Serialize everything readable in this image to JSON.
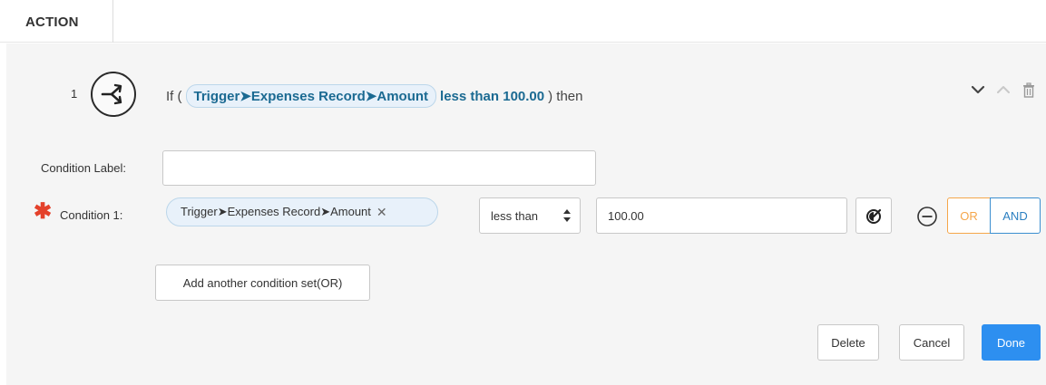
{
  "header": {
    "tab_label": "ACTION"
  },
  "step": {
    "number": "1",
    "icon": "branch-condition-icon",
    "summary": {
      "prefix": "If (",
      "field": "Trigger➤Expenses Record➤Amount",
      "operator_value": "less than 100.00",
      "suffix": ") then"
    },
    "controls": [
      "chevron-down-icon",
      "chevron-up-icon",
      "trash-icon"
    ]
  },
  "form": {
    "condition_label": {
      "label": "Condition Label:",
      "value": "",
      "placeholder": ""
    },
    "condition_1": {
      "required_mark": "✱",
      "label": "Condition 1:",
      "field": "Trigger➤Expenses Record➤Amount",
      "remove_symbol": "✕",
      "operator": "less than",
      "value": "100.00"
    },
    "or_label": "OR",
    "and_label": "AND",
    "add_condition_set_label": "Add another condition set(OR)"
  },
  "actions": {
    "delete_label": "Delete",
    "cancel_label": "Cancel",
    "done_label": "Done"
  },
  "colors": {
    "primary": "#2d8ff0",
    "or_accent": "#f5a64a",
    "and_accent": "#2b7fc1",
    "required": "#e4412b",
    "pill_bg": "#e8f1fa",
    "panel_bg": "#f5f5f5"
  }
}
